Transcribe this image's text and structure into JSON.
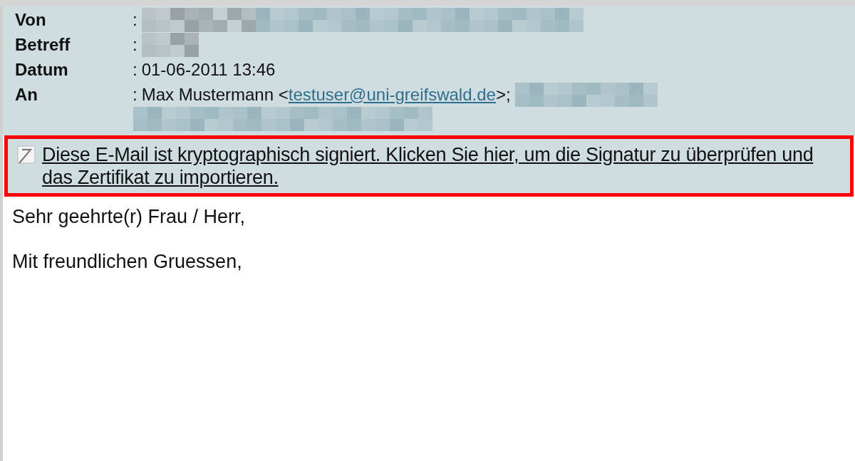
{
  "header": [
    {
      "label": "Von",
      "colon": ":",
      "redacted": true,
      "wrapped_redaction": false
    },
    {
      "label": "Betreff",
      "colon": ":",
      "redacted": true,
      "wrapped_redaction": false
    },
    {
      "label": "Datum",
      "colon": ":",
      "value": "01-06-2011 13:46",
      "redacted": false,
      "wrapped_redaction": false
    },
    {
      "label": "An",
      "colon": ":",
      "value": "Max Mustermann <",
      "link": "testuser@uni-greifswald.de",
      "after": ">;",
      "redacted": true,
      "wrapped_redaction": true
    }
  ],
  "signature_notice": {
    "text": "Diese E-Mail ist kryptographisch signiert. Klicken Sie hier, um die Signatur zu überprüfen und das Zertifikat zu importieren.",
    "highlighted": true
  },
  "body": [
    "Sehr geehrte(r) Frau / Herr,",
    "Mit freundlichen Gruessen,"
  ]
}
